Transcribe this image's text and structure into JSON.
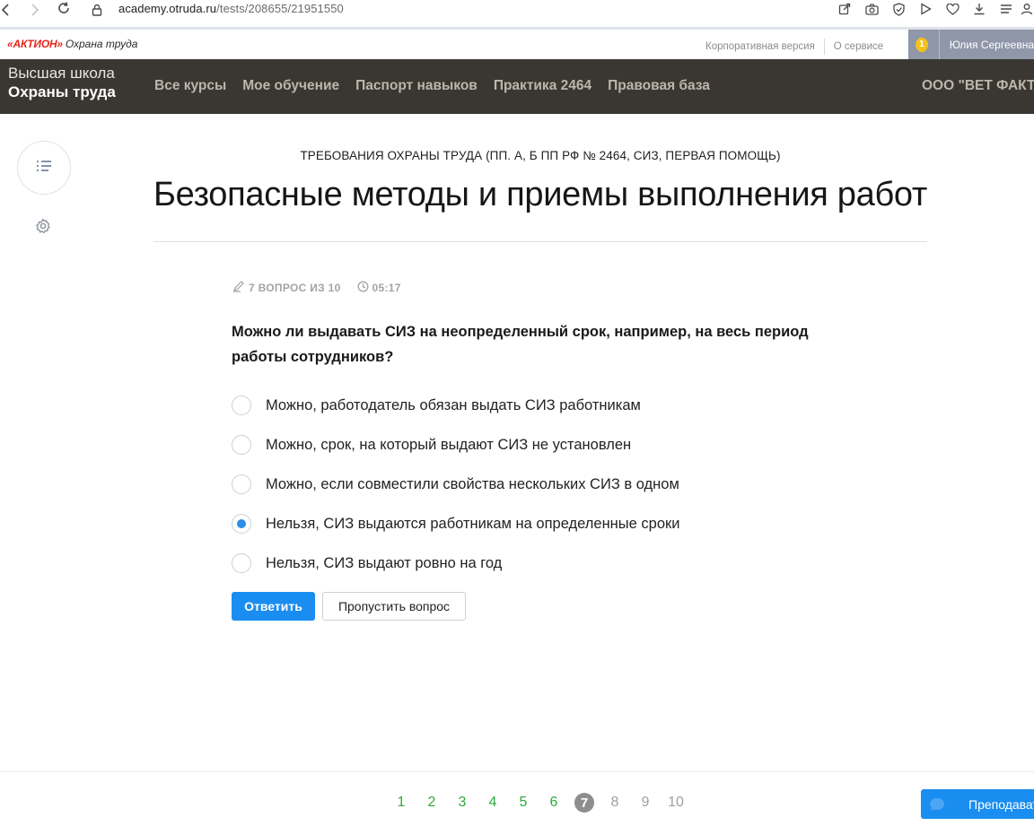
{
  "browser": {
    "url_host": "academy.otruda.ru",
    "url_path": "/tests/208655/21951550"
  },
  "top_strip": {
    "brand_logo": "«АКТИОН»",
    "brand_text": "Охрана труда",
    "links": [
      "Корпоративная версия",
      "О сервисе"
    ],
    "notification_count": "1",
    "user_name": "Юлия Сергеевна"
  },
  "header": {
    "school_line1": "Высшая школа",
    "school_line2": "Охраны труда",
    "nav": [
      "Все курсы",
      "Мое обучение",
      "Паспорт навыков",
      "Практика 2464",
      "Правовая база"
    ],
    "org": "ООО \"ВЕТ ФАКТ"
  },
  "content": {
    "course_title": "ТРЕБОВАНИЯ ОХРАНЫ ТРУДА (ПП. А, Б ПП РФ № 2464, СИЗ, ПЕРВАЯ ПОМОЩЬ)",
    "lesson_title": "Безопасные методы и приемы выполнения работ",
    "progress_label": "7 ВОПРОС ИЗ 10",
    "timer": "05:17",
    "question": "Можно ли выдавать СИЗ на неопределенный срок, например, на весь период работы сотрудников?",
    "answers": [
      {
        "text": "Можно, работодатель обязан выдать СИЗ работникам",
        "selected": false
      },
      {
        "text": "Можно, срок, на который выдают СИЗ не установлен",
        "selected": false
      },
      {
        "text": "Можно, если совместили свойства нескольких СИЗ в одном",
        "selected": false
      },
      {
        "text": "Нельзя, СИЗ выдаются работникам на определенные сроки",
        "selected": true
      },
      {
        "text": "Нельзя, СИЗ выдают ровно на год",
        "selected": false
      }
    ],
    "submit_label": "Ответить",
    "skip_label": "Пропустить вопрос"
  },
  "pager": {
    "pages": [
      "1",
      "2",
      "3",
      "4",
      "5",
      "6",
      "7",
      "8",
      "9",
      "10"
    ],
    "current": 7,
    "teacher_label": "Преподавател"
  },
  "colors": {
    "header_bg": "#3a3631",
    "accent_blue": "#1a8df0",
    "done_green": "#2eaa3a",
    "brand_red": "#e3261c"
  }
}
